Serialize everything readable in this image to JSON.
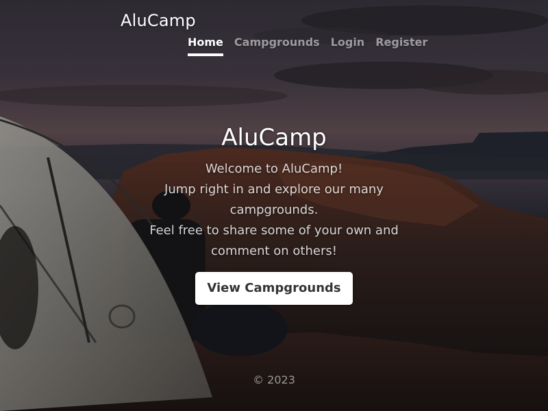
{
  "brand": "AluCamp",
  "nav": {
    "items": [
      {
        "label": "Home"
      },
      {
        "label": "Campgrounds"
      },
      {
        "label": "Login"
      },
      {
        "label": "Register"
      }
    ]
  },
  "hero": {
    "title": "AluCamp",
    "lines": [
      "Welcome to AluCamp!",
      "Jump right in and explore our many campgrounds.",
      "Feel free to share some of your own and comment on others!"
    ],
    "button_label": "View Campgrounds"
  },
  "footer": {
    "text": "© 2023"
  },
  "colors": {
    "button_bg": "#ffffff",
    "button_text": "#333333",
    "active_link": "#ffffff",
    "inactive_link": "#8f8c8f"
  }
}
